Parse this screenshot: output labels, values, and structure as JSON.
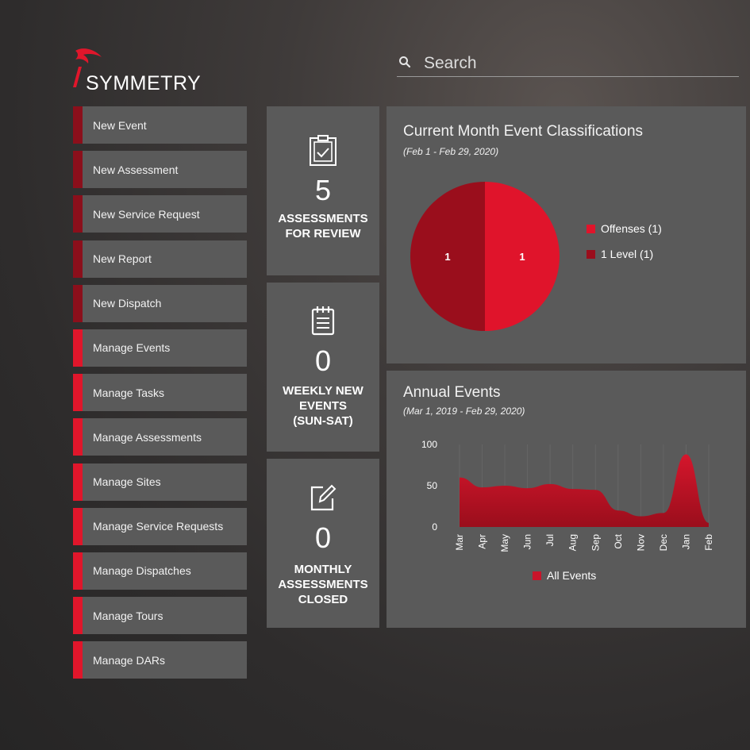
{
  "logo": {
    "text": "SYMMETRY"
  },
  "search": {
    "placeholder": "Search"
  },
  "nav": [
    {
      "label": "New Event",
      "accent": "#8b0f1b"
    },
    {
      "label": "New Assessment",
      "accent": "#8b0f1b"
    },
    {
      "label": "New Service Request",
      "accent": "#8b0f1b"
    },
    {
      "label": "New Report",
      "accent": "#8b0f1b"
    },
    {
      "label": "New Dispatch",
      "accent": "#8b0f1b"
    },
    {
      "label": "Manage Events",
      "accent": "#e0162b"
    },
    {
      "label": "Manage Tasks",
      "accent": "#e0162b"
    },
    {
      "label": "Manage Assessments",
      "accent": "#e0162b"
    },
    {
      "label": "Manage Sites",
      "accent": "#e0162b"
    },
    {
      "label": "Manage Service Requests",
      "accent": "#e0162b"
    },
    {
      "label": "Manage Dispatches",
      "accent": "#e0162b"
    },
    {
      "label": "Manage Tours",
      "accent": "#e0162b"
    },
    {
      "label": "Manage DARs",
      "accent": "#e0162b"
    }
  ],
  "tiles": [
    {
      "icon": "clipboard-check-icon",
      "value": "5",
      "caption_line1": "ASSESSMENTS",
      "caption_line2": "FOR REVIEW",
      "caption_line3": ""
    },
    {
      "icon": "notepad-icon",
      "value": "0",
      "caption_line1": "WEEKLY NEW",
      "caption_line2": "EVENTS",
      "caption_line3": "(SUN-SAT)"
    },
    {
      "icon": "edit-icon",
      "value": "0",
      "caption_line1": "MONTHLY",
      "caption_line2": "ASSESSMENTS",
      "caption_line3": "CLOSED"
    }
  ],
  "classifications_panel": {
    "title": "Current Month Event Classifications",
    "subtitle": "(Feb 1 - Feb 29, 2020)"
  },
  "annual_panel": {
    "title": "Annual Events",
    "subtitle": "(Mar 1, 2019 - Feb 29, 2020)"
  },
  "colors": {
    "bright_red": "#e0142b",
    "dark_red": "#9a0e1c",
    "panel": "#5a5a5a"
  },
  "chart_data": [
    {
      "type": "pie",
      "title": "Current Month Event Classifications",
      "subtitle": "(Feb 1 - Feb 29, 2020)",
      "slices": [
        {
          "label": "Offenses (1)",
          "value": 1,
          "color": "#e0142b"
        },
        {
          "label": "1 Level (1)",
          "value": 1,
          "color": "#9a0e1c"
        }
      ],
      "data_labels": [
        "1",
        "1"
      ],
      "legend_position": "right"
    },
    {
      "type": "area",
      "title": "Annual Events",
      "subtitle": "(Mar 1, 2019 - Feb 29, 2020)",
      "categories": [
        "Mar",
        "Apr",
        "May",
        "Jun",
        "Jul",
        "Aug",
        "Sep",
        "Oct",
        "Nov",
        "Dec",
        "Jan",
        "Feb"
      ],
      "series": [
        {
          "name": "All Events",
          "values": [
            60,
            48,
            50,
            47,
            52,
            46,
            45,
            20,
            13,
            17,
            88,
            5
          ],
          "color": "#c8142a"
        }
      ],
      "yticks": [
        0,
        50,
        100
      ],
      "ylim": [
        0,
        100
      ],
      "legend_position": "bottom"
    }
  ]
}
